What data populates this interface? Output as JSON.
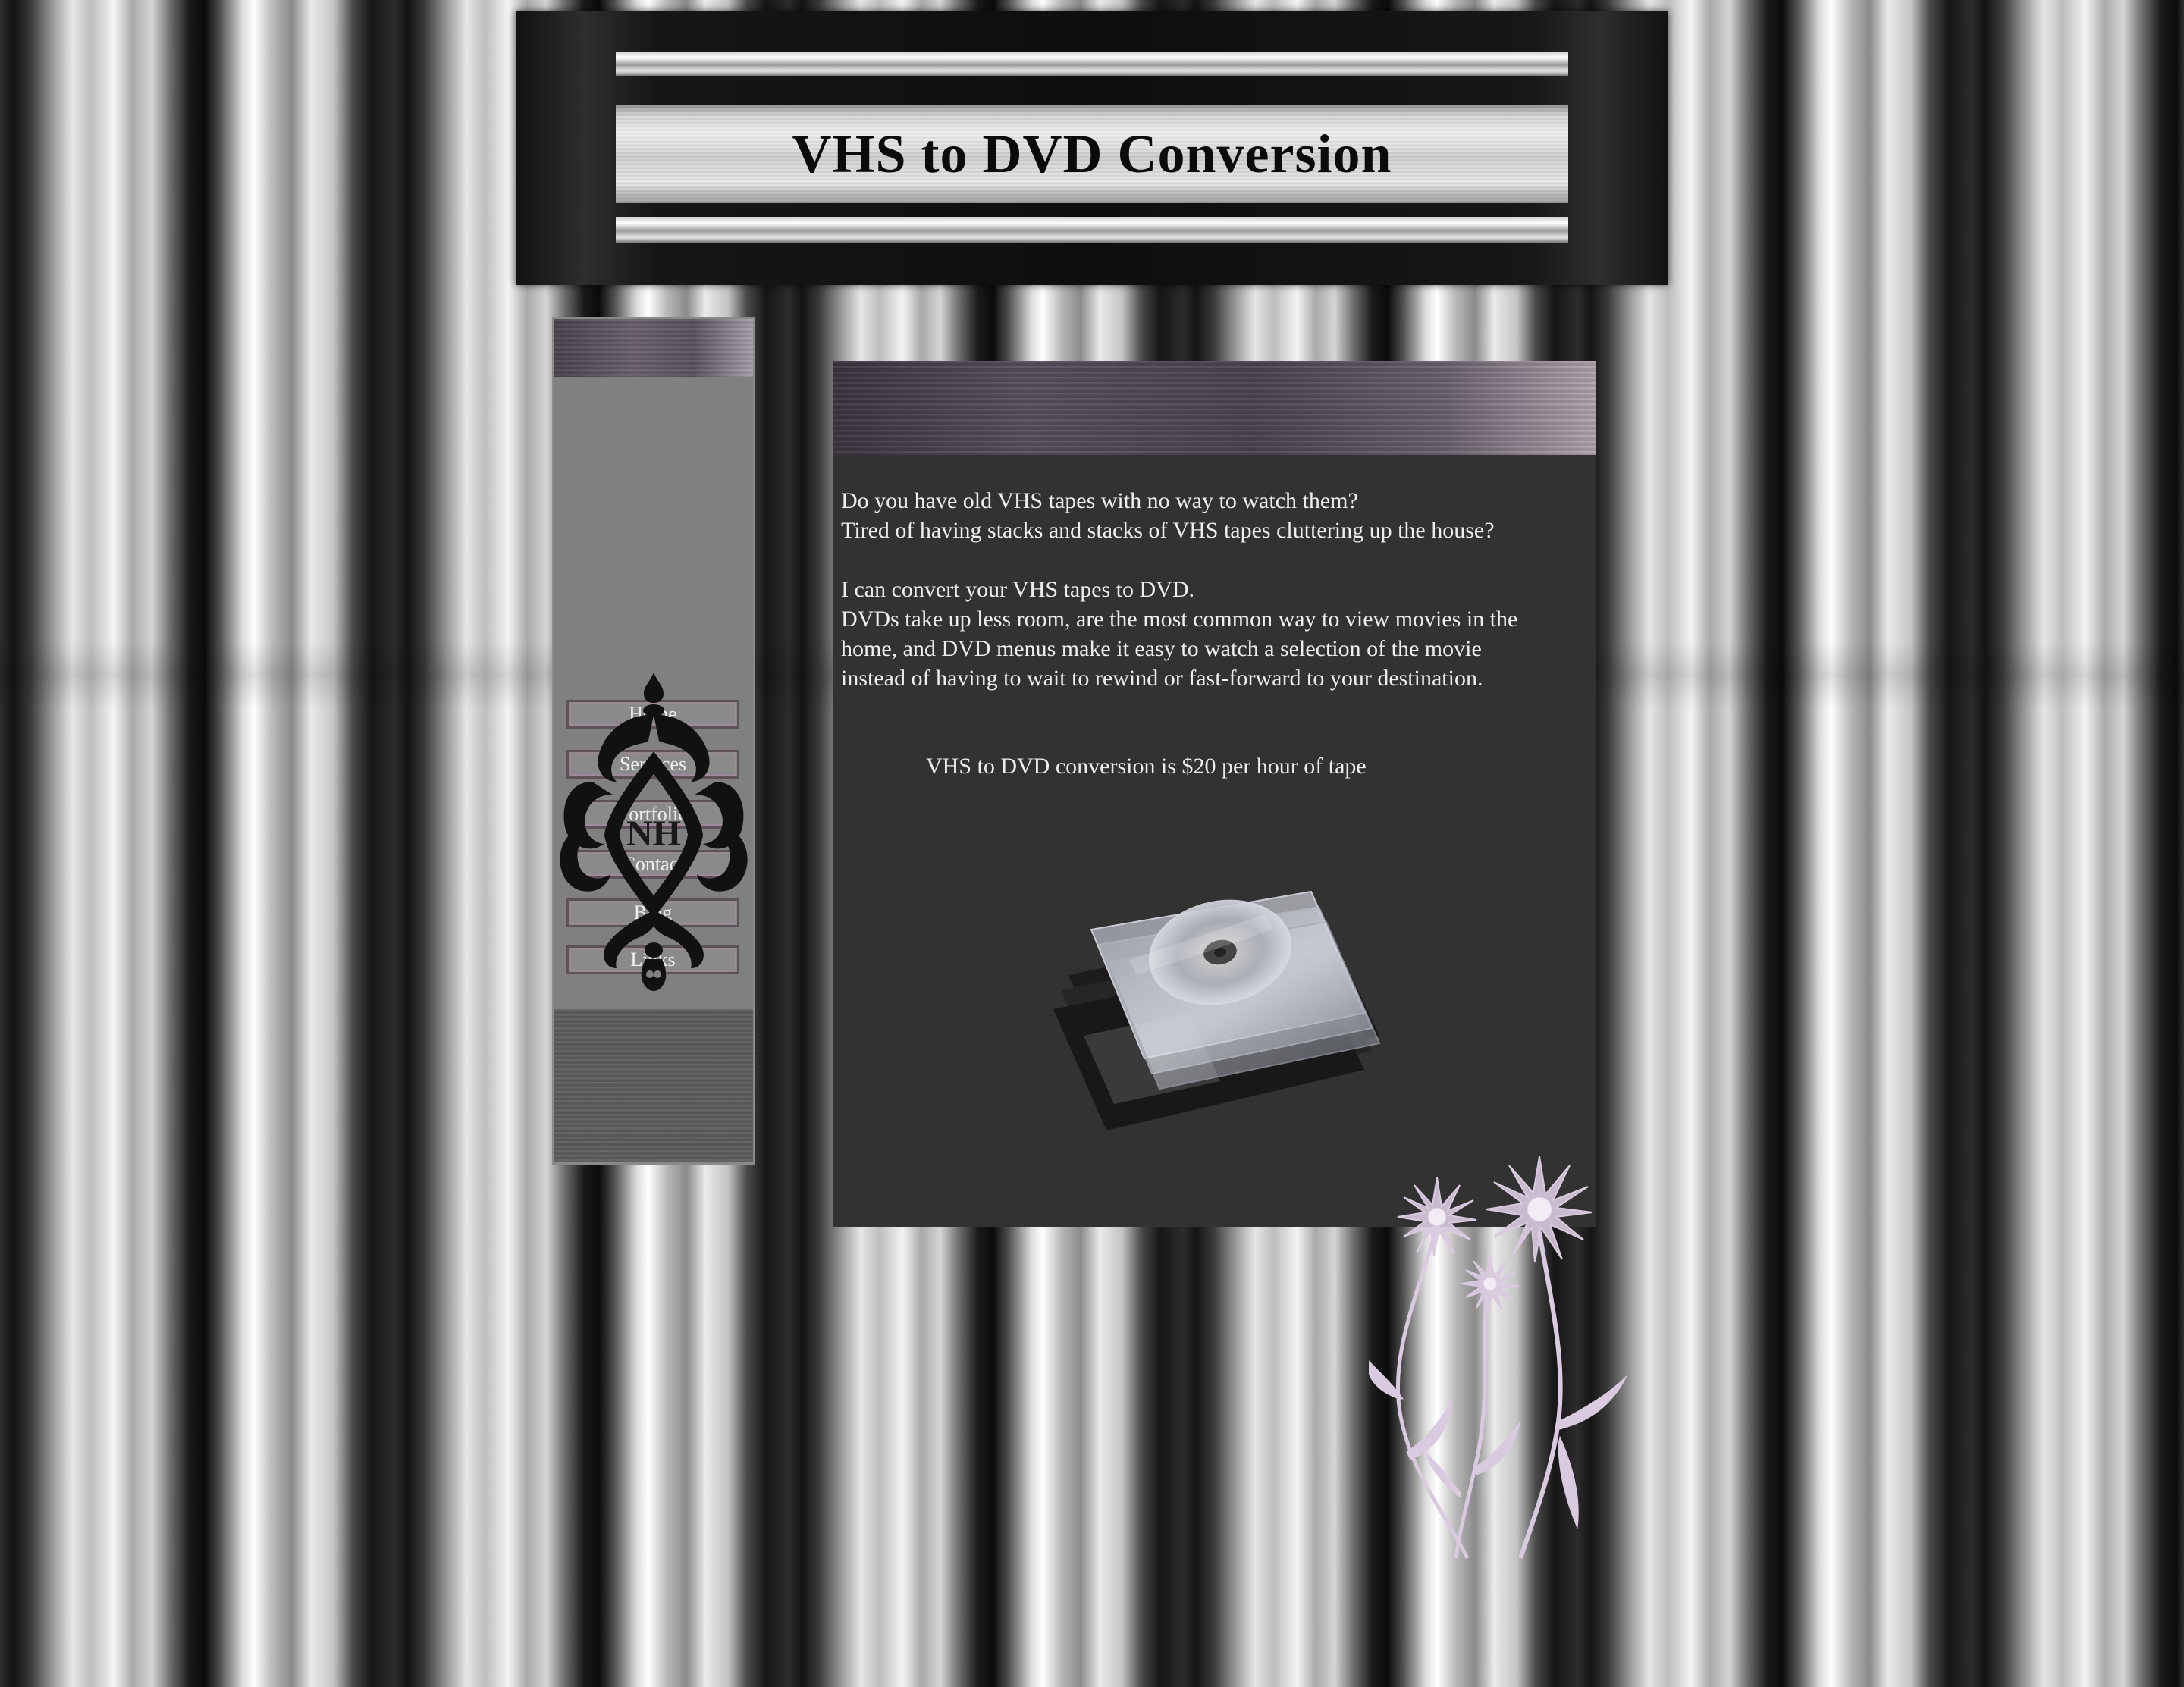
{
  "header": {
    "title": "VHS to DVD Conversion"
  },
  "nav": {
    "items": [
      {
        "label": "Home"
      },
      {
        "label": "Services"
      },
      {
        "label": "Portfolio"
      },
      {
        "label": "Contact"
      },
      {
        "label": "Blog"
      },
      {
        "label": "Links"
      }
    ],
    "logo_text": "NH"
  },
  "content": {
    "paragraph1": [
      "Do you have old VHS tapes with no way to watch them?",
      "Tired of having stacks and stacks of VHS tapes cluttering up the house?"
    ],
    "paragraph2": [
      "I can convert your VHS tapes to DVD.",
      "DVDs take up less room, are the most common way to view movies in the",
      "home, and DVD menus make it easy to watch a selection of the movie",
      "instead of having to wait to rewind or fast-forward to your destination."
    ],
    "price_line": "VHS to DVD conversion is $20 per hour of tape"
  },
  "colors": {
    "panel": "#323232",
    "nav": "#808080",
    "accent_lavender": "#d6c8dc",
    "text": "#eeeeee"
  }
}
